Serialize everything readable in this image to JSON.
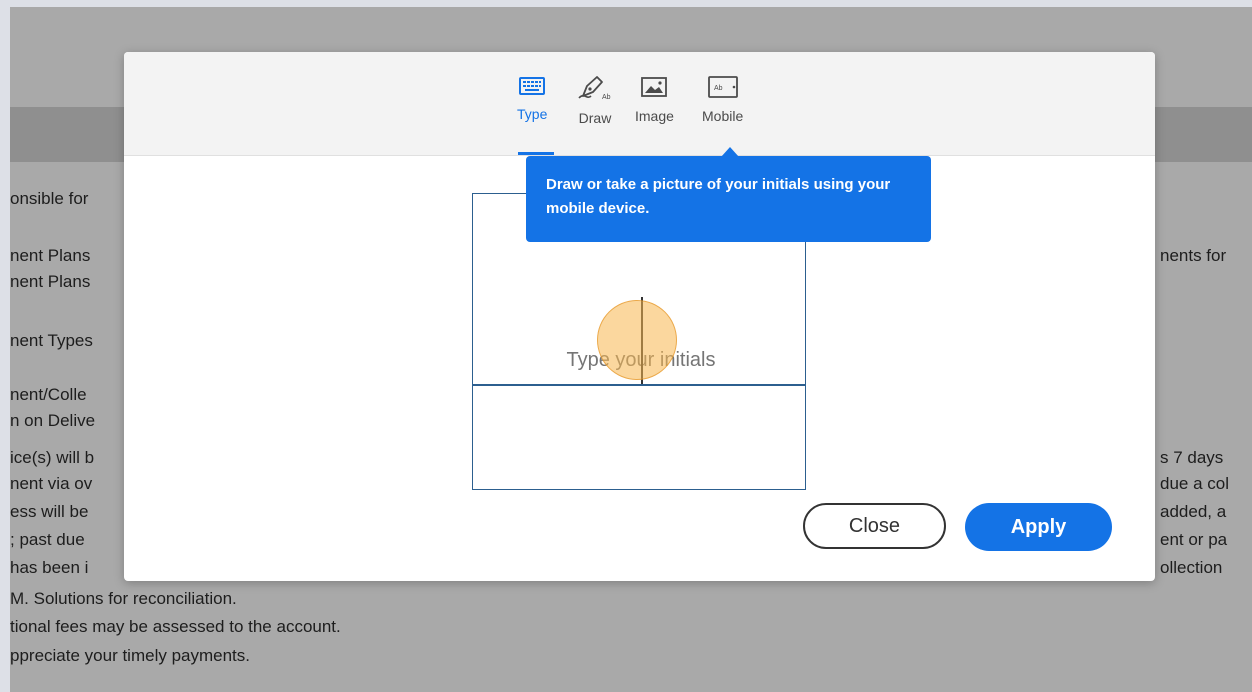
{
  "document": {
    "left_lines": [
      "onsible for",
      "nent Plans",
      "nent Plans",
      "nent Types",
      "nent/Colle",
      "n on Delive",
      "ice(s) will b",
      "nent via ov",
      "ess will be",
      "; past due",
      "has been i",
      "M. Solutions for reconciliation.",
      "tional fees may be assessed to the account.",
      "ppreciate your timely payments."
    ],
    "right_lines": [
      "nents for",
      "s 7 days",
      "due a col",
      "added, a",
      "ent or pa",
      "ollection"
    ]
  },
  "dialog": {
    "tabs": [
      {
        "label": "Type",
        "icon": "keyboard-icon",
        "active": true
      },
      {
        "label": "Draw",
        "icon": "pen-icon",
        "active": false
      },
      {
        "label": "Image",
        "icon": "image-icon",
        "active": false
      },
      {
        "label": "Mobile",
        "icon": "mobile-device-icon",
        "active": false
      }
    ],
    "tooltip": "Draw or take a picture of your initials using your mobile device.",
    "input_placeholder": "Type your initials",
    "close_label": "Close",
    "apply_label": "Apply"
  },
  "colors": {
    "accent": "#1473e6",
    "overlay": "#a9a9a9"
  }
}
